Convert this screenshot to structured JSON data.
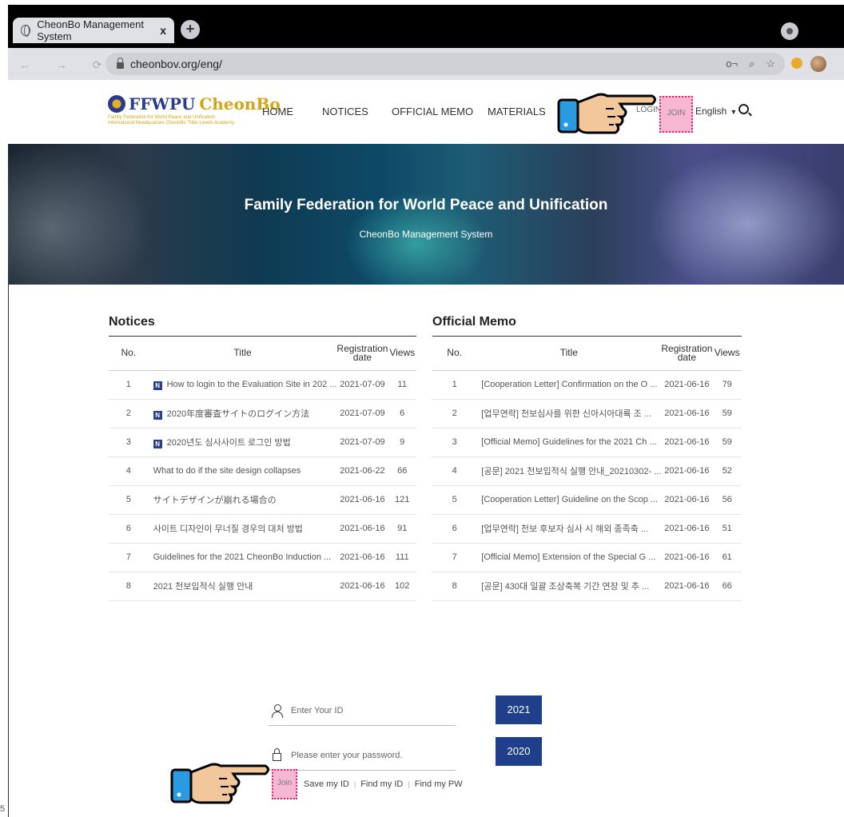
{
  "browser": {
    "tab_title": "CheonBo Management System",
    "tab_close": "x",
    "new_tab": "+",
    "url": "cheonbov.org/eng/",
    "nav_buttons": "← → ⟳ ⌂",
    "omnibox_icons": [
      "o¬",
      "⌕",
      "☆"
    ]
  },
  "header": {
    "logo_main": "FFWPU",
    "logo_accent": "CheonBo",
    "logo_sub": "Family Federation for World Peace and Unification International Headquarters CheonBo Tribe Levels Academy",
    "nav": [
      "HOME",
      "NOTICES",
      "OFFICIAL MEMO",
      "MATERIALS"
    ],
    "login": "LOGIN",
    "join": "JOIN",
    "language": "English",
    "caret": "▼"
  },
  "banner": {
    "title": "Family Federation for World Peace and Unification",
    "subtitle": "CheonBo Management System"
  },
  "notices": {
    "heading": "Notices",
    "columns": [
      "No.",
      "Title",
      "Registration date",
      "Views"
    ],
    "badge": "N",
    "rows": [
      {
        "no": "1",
        "title": "How to login to the Evaluation Site in 202 ...",
        "date": "2021-07-09",
        "views": "11",
        "new": true
      },
      {
        "no": "2",
        "title": "2020年度審査サイトのログイン方法",
        "date": "2021-07-09",
        "views": "6",
        "new": true
      },
      {
        "no": "3",
        "title": "2020년도 심사사이트 로그인 방법",
        "date": "2021-07-09",
        "views": "9",
        "new": true
      },
      {
        "no": "4",
        "title": "What to do if the site design collapses",
        "date": "2021-06-22",
        "views": "66",
        "new": false
      },
      {
        "no": "5",
        "title": "サイトデザインが崩れる場合の",
        "date": "2021-06-16",
        "views": "121",
        "new": false
      },
      {
        "no": "6",
        "title": "사이트 디자인이 무너질 경우의 대처 방법",
        "date": "2021-06-16",
        "views": "91",
        "new": false
      },
      {
        "no": "7",
        "title": "Guidelines for the 2021 CheonBo Induction ...",
        "date": "2021-06-16",
        "views": "111",
        "new": false
      },
      {
        "no": "8",
        "title": "2021 천보입적식 실행 안내",
        "date": "2021-06-16",
        "views": "102",
        "new": false
      }
    ]
  },
  "memo": {
    "heading": "Official Memo",
    "columns": [
      "No.",
      "Title",
      "Registration date",
      "Views"
    ],
    "rows": [
      {
        "no": "1",
        "title": "[Cooperation Letter] Confirmation on the O ...",
        "date": "2021-06-16",
        "views": "79"
      },
      {
        "no": "2",
        "title": "[업무연락] 천보심사를 위한 신아시아대륙 조 ...",
        "date": "2021-06-16",
        "views": "59"
      },
      {
        "no": "3",
        "title": "[Official Memo] Guidelines for the 2021 Ch ...",
        "date": "2021-06-16",
        "views": "59"
      },
      {
        "no": "4",
        "title": "[공문] 2021 천보입적식 실행 안내_20210302- ...",
        "date": "2021-06-16",
        "views": "52"
      },
      {
        "no": "5",
        "title": "[Cooperation Letter] Guideline on the Scop ...",
        "date": "2021-06-16",
        "views": "56"
      },
      {
        "no": "6",
        "title": "[업무연락] 천보 후보자 심사 시 해외 종족축 ...",
        "date": "2021-06-16",
        "views": "51"
      },
      {
        "no": "7",
        "title": "[Official Memo] Extension of the Special G ...",
        "date": "2021-06-16",
        "views": "61"
      },
      {
        "no": "8",
        "title": "[공문] 430대 일괄 조상축복 기간 연장 및 추 ...",
        "date": "2021-06-16",
        "views": "66"
      }
    ]
  },
  "login": {
    "id_placeholder": "Enter Your ID",
    "pw_placeholder": "Please enter your password.",
    "join": "Join",
    "save_id": "Save my ID",
    "find_id": "Find my ID",
    "find_pw": "Find my PW",
    "separator": "|",
    "year_2021": "2021",
    "year_2020": "2020"
  },
  "corner_mark": "5",
  "colors": {
    "accent": "#1f3f8a",
    "highlight": "#f6b7d2",
    "highlight_border": "#d6297a"
  }
}
